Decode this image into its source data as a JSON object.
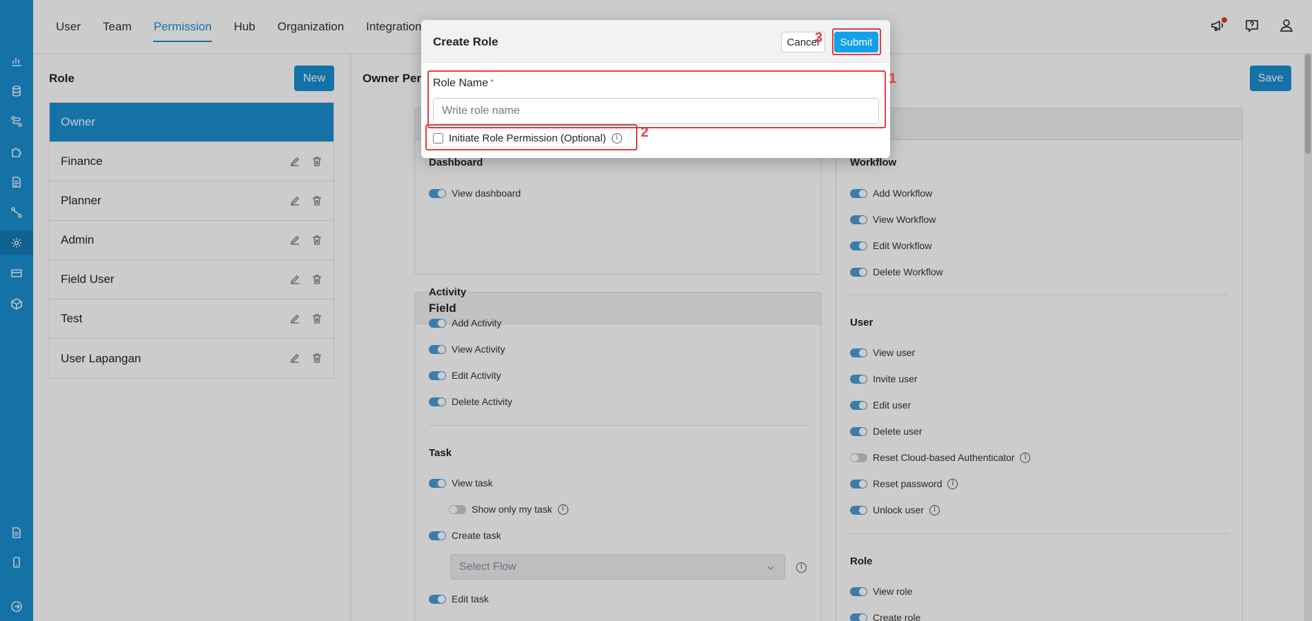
{
  "nav": {
    "tabs": [
      {
        "label": "User"
      },
      {
        "label": "Team"
      },
      {
        "label": "Permission"
      },
      {
        "label": "Hub"
      },
      {
        "label": "Organization"
      },
      {
        "label": "Integration"
      }
    ],
    "active_tab": "Permission"
  },
  "rail_icons": [
    "chart-icon",
    "database-icon",
    "flow-icon",
    "puzzle-icon",
    "document-icon",
    "route-icon",
    "gear-icon",
    "card-icon",
    "box-icon",
    "report-icon",
    "mobile-icon",
    "logout-icon"
  ],
  "top_icons": [
    "megaphone-icon",
    "help-icon",
    "user-icon"
  ],
  "roles": {
    "title": "Role",
    "new_label": "New",
    "items": [
      {
        "label": "Owner"
      },
      {
        "label": "Finance"
      },
      {
        "label": "Planner"
      },
      {
        "label": "Admin"
      },
      {
        "label": "Field User"
      },
      {
        "label": "Test"
      },
      {
        "label": "User Lapangan"
      }
    ],
    "selected": "Owner"
  },
  "permission": {
    "title": "Owner Per",
    "save_label": "Save",
    "dashboard": {
      "heading": "Dashboard",
      "rows": [
        {
          "label": "View dashboard",
          "on": true
        }
      ]
    },
    "field_card": {
      "title": "Field",
      "activity": {
        "heading": "Activity",
        "rows": [
          {
            "label": "Add Activity",
            "on": true
          },
          {
            "label": "View Activity",
            "on": true
          },
          {
            "label": "Edit Activity",
            "on": true
          },
          {
            "label": "Delete Activity",
            "on": true
          }
        ]
      },
      "task": {
        "heading": "Task",
        "rows": [
          {
            "label": "View task",
            "on": true
          },
          {
            "label": "Show only my task",
            "on": false
          },
          {
            "label": "Create task",
            "on": true
          },
          {
            "label": "Edit task",
            "on": true
          }
        ],
        "select_placeholder": "Select Flow"
      }
    },
    "workflow": {
      "heading": "Workflow",
      "rows": [
        {
          "label": "Add Workflow",
          "on": true
        },
        {
          "label": "View Workflow",
          "on": true
        },
        {
          "label": "Edit Workflow",
          "on": true
        },
        {
          "label": "Delete Workflow",
          "on": true
        }
      ]
    },
    "user": {
      "heading": "User",
      "rows": [
        {
          "label": "View user",
          "on": true
        },
        {
          "label": "Invite user",
          "on": true
        },
        {
          "label": "Edit user",
          "on": true
        },
        {
          "label": "Delete user",
          "on": true
        },
        {
          "label": "Reset Cloud-based Authenticator",
          "on": false
        },
        {
          "label": "Reset password",
          "on": true
        },
        {
          "label": "Unlock user",
          "on": true
        }
      ]
    },
    "role": {
      "heading": "Role",
      "rows": [
        {
          "label": "View role",
          "on": true
        },
        {
          "label": "Create role",
          "on": true
        }
      ]
    }
  },
  "modal": {
    "title": "Create Role",
    "cancel_label": "Cancel",
    "submit_label": "Submit",
    "field_label": "Role Name",
    "required_mark": "*",
    "placeholder": "Write role name",
    "value": "",
    "checkbox_label": "Initiate Role Permission (Optional)",
    "checkbox_checked": false,
    "info_glyph": "i"
  },
  "annotations": [
    "1",
    "2",
    "3"
  ],
  "colors": {
    "brand": "#1a8fd1",
    "submit": "#12a0e8",
    "annotation": "#e03c3c",
    "toggle_on": "#4a9bd6",
    "toggle_off": "#c9cbcf"
  }
}
